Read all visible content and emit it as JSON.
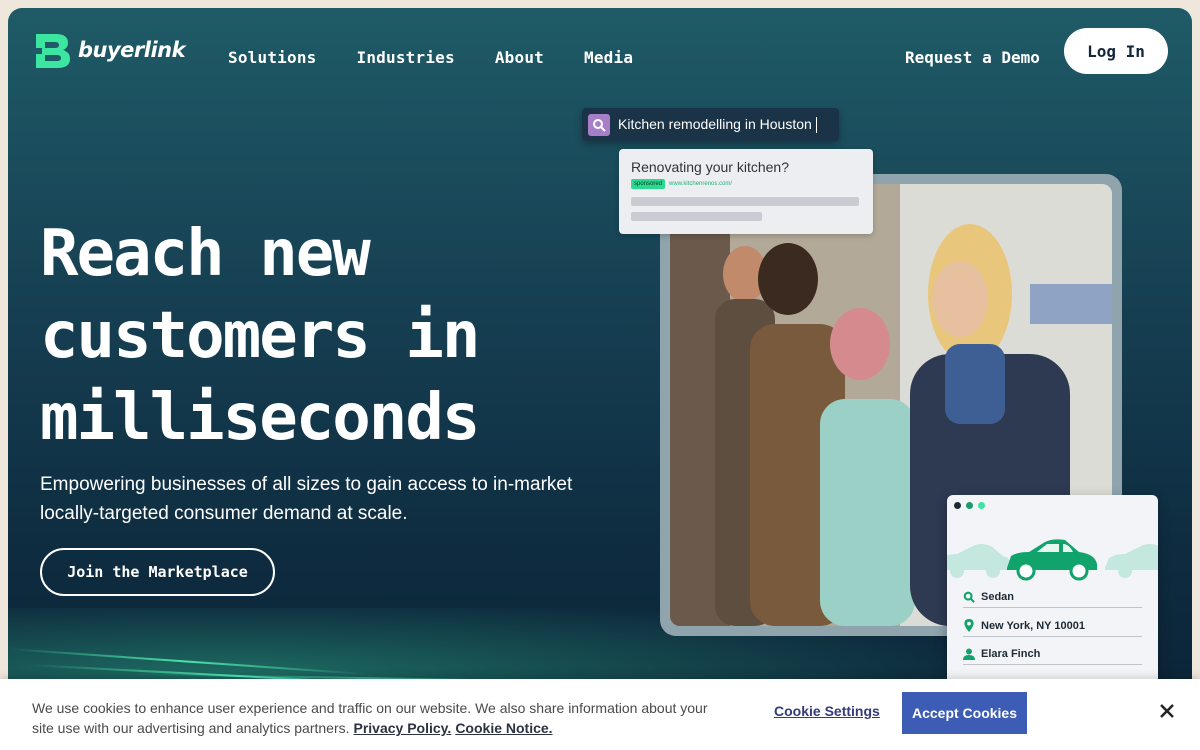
{
  "brand": {
    "name": "buyerlink",
    "accent": "#3ce6a0"
  },
  "nav": {
    "items": [
      {
        "label": "Solutions"
      },
      {
        "label": "Industries"
      },
      {
        "label": "About"
      },
      {
        "label": "Media"
      }
    ],
    "demo_label": "Request a Demo",
    "login_label": "Log In"
  },
  "hero": {
    "headline_lines": [
      "Reach new",
      "customers in",
      "milliseconds"
    ],
    "subtitle": "Empowering businesses of all sizes to gain access to in-market locally-targeted consumer demand at scale.",
    "cta_label": "Join the Marketplace"
  },
  "search_card": {
    "query": "Kitchen remodelling in Houston",
    "ad_title": "Renovating your kitchen?",
    "ad_badge": "sponsored",
    "ad_url": "www.kitchenrenos.com/"
  },
  "lead_card": {
    "rows": [
      {
        "icon": "search-icon",
        "text": "Sedan"
      },
      {
        "icon": "location-pin-icon",
        "text": "New York, NY 10001"
      },
      {
        "icon": "person-icon",
        "text": "Elara Finch"
      }
    ]
  },
  "cookie": {
    "text": "We use cookies to enhance user experience and traffic on our website. We also share information about your site use with our advertising and analytics partners.",
    "privacy_label": "Privacy Policy.",
    "cookie_notice_label": "Cookie Notice.",
    "settings_label": "Cookie Settings",
    "accept_label": "Accept Cookies",
    "accept_color": "#3c5cb5"
  }
}
